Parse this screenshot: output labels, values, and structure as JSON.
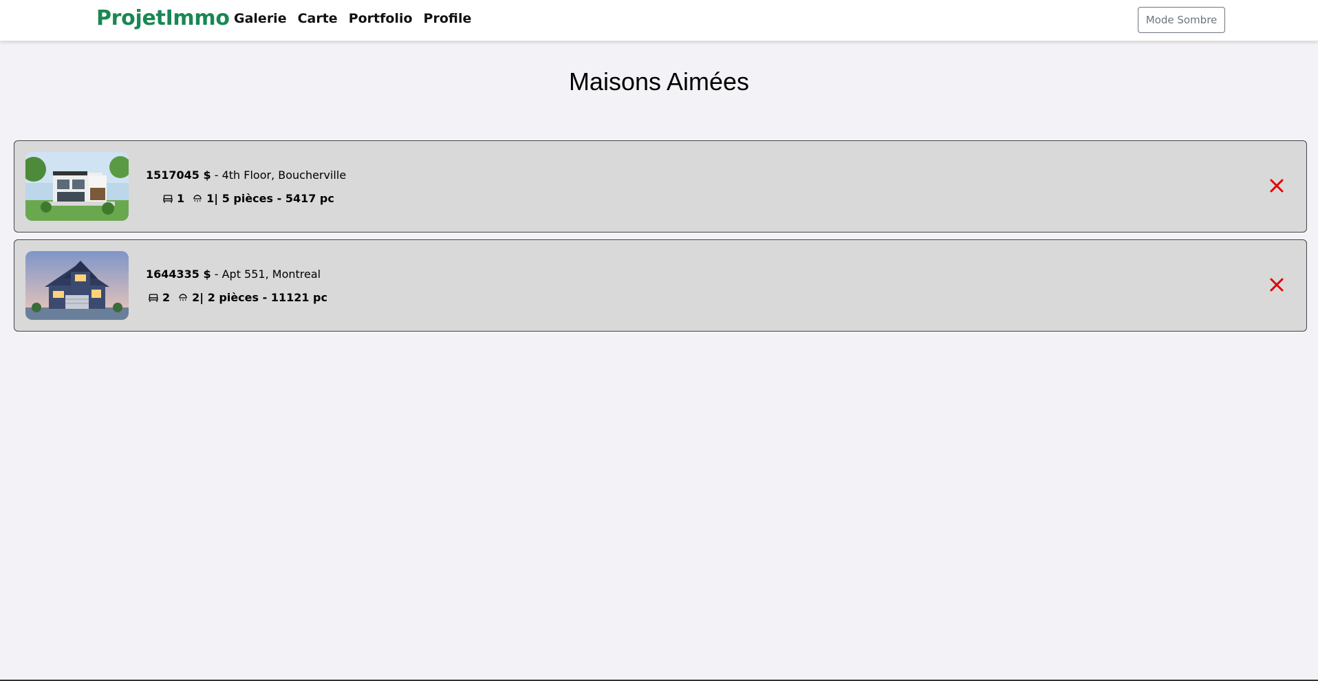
{
  "nav": {
    "brand": "ProjetImmo",
    "links": [
      "Galerie",
      "Carte",
      "Portfolio",
      "Profile"
    ],
    "mode_button": "Mode Sombre",
    "brand_color": "#198754"
  },
  "page": {
    "title": "Maisons Aimées"
  },
  "listings": [
    {
      "price": "1517045 $",
      "address": " - 4th Floor, Boucherville",
      "beds": "1",
      "baths_rooms_area": "1| 5 pièces - 5417 pc",
      "image": "modern-house-photo"
    },
    {
      "price": "1644335 $",
      "address": " - Apt 551, Montreal",
      "beds": "2",
      "baths_rooms_area": "2| 2 pièces - 11121 pc",
      "image": "suburban-house-photo"
    }
  ],
  "colors": {
    "remove": "#e00000",
    "card_bg": "#d9d9d9",
    "page_bg": "#f3f3f7"
  }
}
